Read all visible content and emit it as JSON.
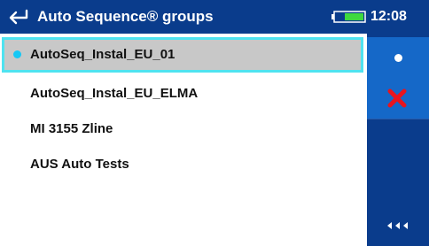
{
  "header": {
    "title": "Auto Sequence® groups",
    "time": "12:08",
    "back_icon": "back-arrow-icon",
    "battery_icon": "battery-icon"
  },
  "list": {
    "items": [
      {
        "label": "AutoSeq_Instal_EU_01",
        "selected": true
      },
      {
        "label": "AutoSeq_Instal_EU_ELMA",
        "selected": false
      },
      {
        "label": "MI 3155 Zline",
        "selected": false
      },
      {
        "label": "AUS Auto Tests",
        "selected": false
      }
    ]
  },
  "sidebar": {
    "buttons": [
      {
        "name": "select-dot-icon"
      },
      {
        "name": "delete-x-icon"
      },
      {
        "name": "collapse-arrows-icon"
      }
    ]
  },
  "colors": {
    "header_bg": "#0a3c8c",
    "button_bg": "#1568c8",
    "selection_border": "#4fe3f0",
    "selection_bg": "#c8c8c8",
    "dot": "#15c8f5",
    "delete": "#e8141e"
  }
}
